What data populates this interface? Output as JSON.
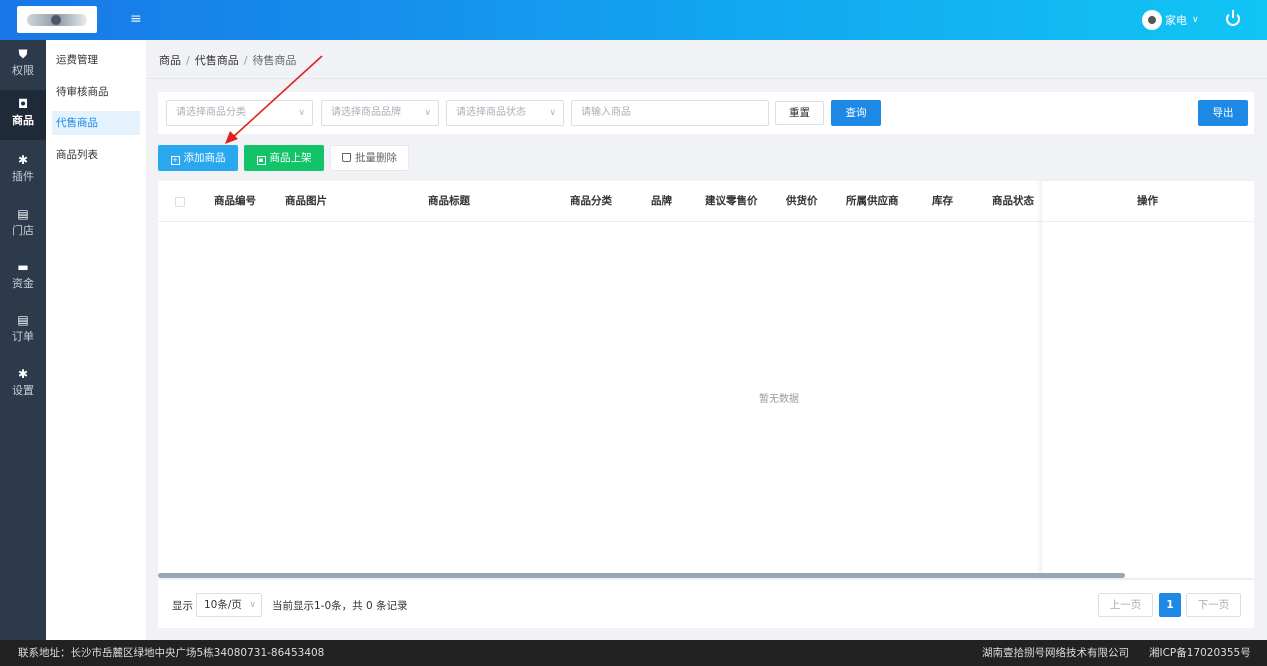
{
  "header": {
    "user_label": "家电"
  },
  "nav": [
    {
      "label": "权限"
    },
    {
      "label": "商品"
    },
    {
      "label": "插件"
    },
    {
      "label": "门店"
    },
    {
      "label": "资金"
    },
    {
      "label": "订单"
    },
    {
      "label": "设置"
    }
  ],
  "submenu": [
    {
      "label": "运费管理"
    },
    {
      "label": "待审核商品"
    },
    {
      "label": "代售商品"
    },
    {
      "label": "商品列表"
    }
  ],
  "breadcrumb": {
    "item1": "商品",
    "item2": "代售商品",
    "item3": "待售商品"
  },
  "filters": {
    "category_placeholder": "请选择商品分类",
    "brand_placeholder": "请选择商品品牌",
    "status_placeholder": "请选择商品状态",
    "search_placeholder": "请输入商品",
    "reset_label": "重置",
    "query_label": "查询",
    "export_label": "导出"
  },
  "actions": {
    "add_label": "添加商品",
    "list_label": "商品上架",
    "delete_label": "批量删除"
  },
  "table": {
    "columns": [
      "商品编号",
      "商品图片",
      "商品标题",
      "商品分类",
      "品牌",
      "建议零售价",
      "供货价",
      "所属供应商",
      "库存",
      "商品状态",
      "操作"
    ],
    "empty_text": "暂无数据"
  },
  "pagination": {
    "show_label": "显示",
    "page_size": "10条/页",
    "info": "当前显示1-0条，共 0 条记录",
    "prev_label": "上一页",
    "current_page": "1",
    "next_label": "下一页"
  },
  "footer": {
    "address": "联系地址：长沙市岳麓区绿地中央广场5栋34080731-86453408",
    "company": "湖南壹拾捌号网络技术有限公司",
    "icp": "湘ICP备17020355号"
  },
  "colors": {
    "primary": "#1e88e5",
    "success": "#12c36a",
    "sidebar": "#2d3a4b",
    "annotation": "#e0201b"
  }
}
